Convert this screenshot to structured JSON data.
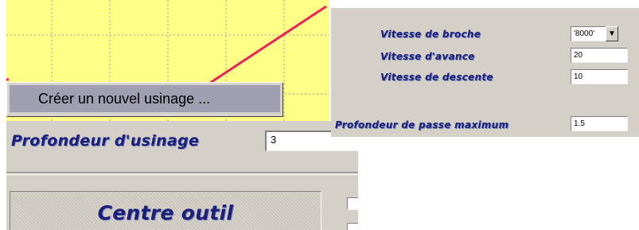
{
  "context_menu": {
    "item_label": "Créer un nouvel usinage ..."
  },
  "left_panel": {
    "depth_label": "Profondeur d'usinage",
    "depth_value": "3",
    "centre_title": "Centre outil"
  },
  "right_panel": {
    "spindle_speed_label": "Vitesse de broche",
    "spindle_speed_value": "'8000'",
    "feed_speed_label": "Vitesse d'avance",
    "feed_speed_value": "20",
    "descent_speed_label": "Vitesse de descente",
    "descent_speed_value": "10",
    "max_pass_depth_label": "Profondeur de passe maximum",
    "max_pass_depth_value": "1.5"
  },
  "colors": {
    "graph_background": "#ffff88",
    "graph_line": "#e8245a",
    "menu_highlight": "#a09fb2",
    "label_text": "#1b1f7a",
    "panel_background": "#d4d0c8"
  },
  "icons": {
    "dropdown": "chevron-down-icon"
  }
}
